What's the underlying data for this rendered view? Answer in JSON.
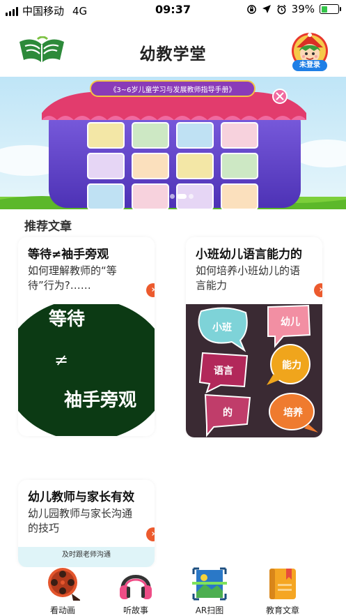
{
  "status_bar": {
    "carrier": "中国移动",
    "network": "4G",
    "time": "09:37",
    "battery_text": "39%",
    "battery_level": 0.39,
    "battery_color": "#35c54a"
  },
  "header": {
    "title": "幼教学堂",
    "login_label": "未登录",
    "accent": "#1f7fe6"
  },
  "banner": {
    "title": "《3~6岁儿童学习与发展教师指导手册》",
    "tiles": [
      "",
      "",
      "",
      "",
      "",
      "",
      "",
      "",
      "",
      "",
      "",
      ""
    ],
    "pages": 3,
    "active_page": 1
  },
  "recommended": {
    "section_title": "推荐文章",
    "articles": [
      {
        "title": "等待≠袖手旁观",
        "desc": "如何理解教师的“等待”行为?……",
        "image_lines": [
          "等待",
          "≠",
          "袖手旁观"
        ]
      },
      {
        "title": "小班幼儿语言能力的",
        "desc": "如何培养小班幼儿的语言能力",
        "image_words": [
          "小班",
          "幼儿",
          "语言",
          "能力",
          "的",
          "培养"
        ]
      },
      {
        "title": "幼儿教师与家长有效",
        "desc": "幼儿园教师与家长沟通的技巧",
        "image_caption": "及时跟老师沟通"
      }
    ]
  },
  "tabbar": {
    "items": [
      {
        "label": "看动画",
        "icon": "film-reel-icon"
      },
      {
        "label": "听故事",
        "icon": "headphones-icon"
      },
      {
        "label": "AR扫图",
        "icon": "ar-scan-icon"
      },
      {
        "label": "教育文章",
        "icon": "book-icon"
      }
    ]
  },
  "colors": {
    "arrow": "#ec5a2d",
    "card_dark_green": "#0c3a14",
    "card_purple": "#3a2a33"
  }
}
